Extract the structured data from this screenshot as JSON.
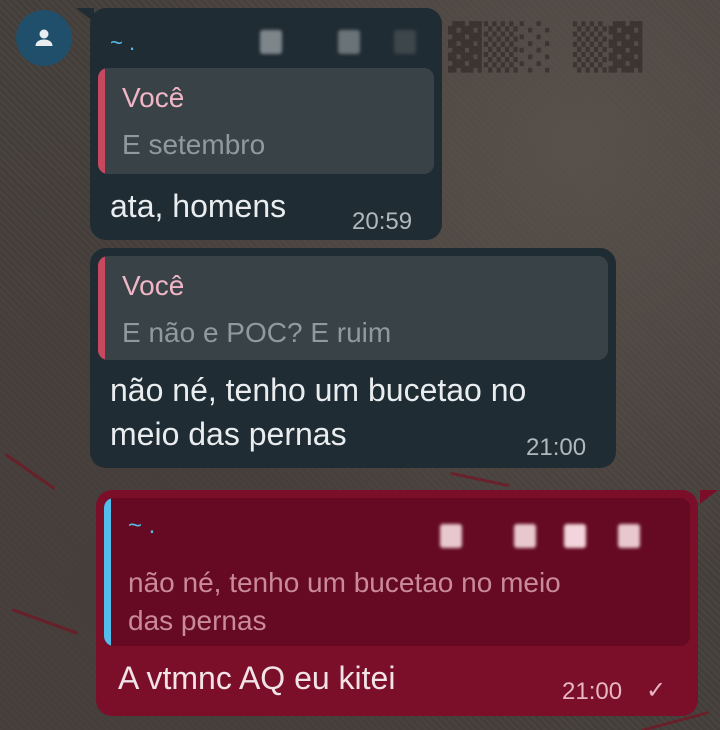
{
  "colors": {
    "incoming_bubble": "#202c33",
    "outgoing_bubble": "#7b0f2a",
    "quote_author_pink": "#f0b6c6",
    "quote_bar_pink": "#c8485f",
    "quote_bar_blue": "#53bdeb",
    "sender_blue": "#53bdeb"
  },
  "contact": {
    "avatar_icon": "person-icon"
  },
  "messages": [
    {
      "direction": "incoming",
      "sender": "~ .",
      "quote": {
        "author": "Você",
        "text": "E setembro"
      },
      "text": "ata, homens",
      "time": "20:59"
    },
    {
      "direction": "incoming",
      "quote": {
        "author": "Você",
        "text": "E não e POC? E ruim"
      },
      "text_lines": [
        "não né, tenho um bucetao no",
        "meio das pernas"
      ],
      "time": "21:00"
    },
    {
      "direction": "outgoing",
      "quote": {
        "author": "~ .",
        "text_lines": [
          "não né, tenho um bucetao no meio",
          "das pernas"
        ]
      },
      "text": "A vtmnc AQ eu kitei",
      "time": "21:00",
      "status_icon": "single-check-icon"
    }
  ]
}
